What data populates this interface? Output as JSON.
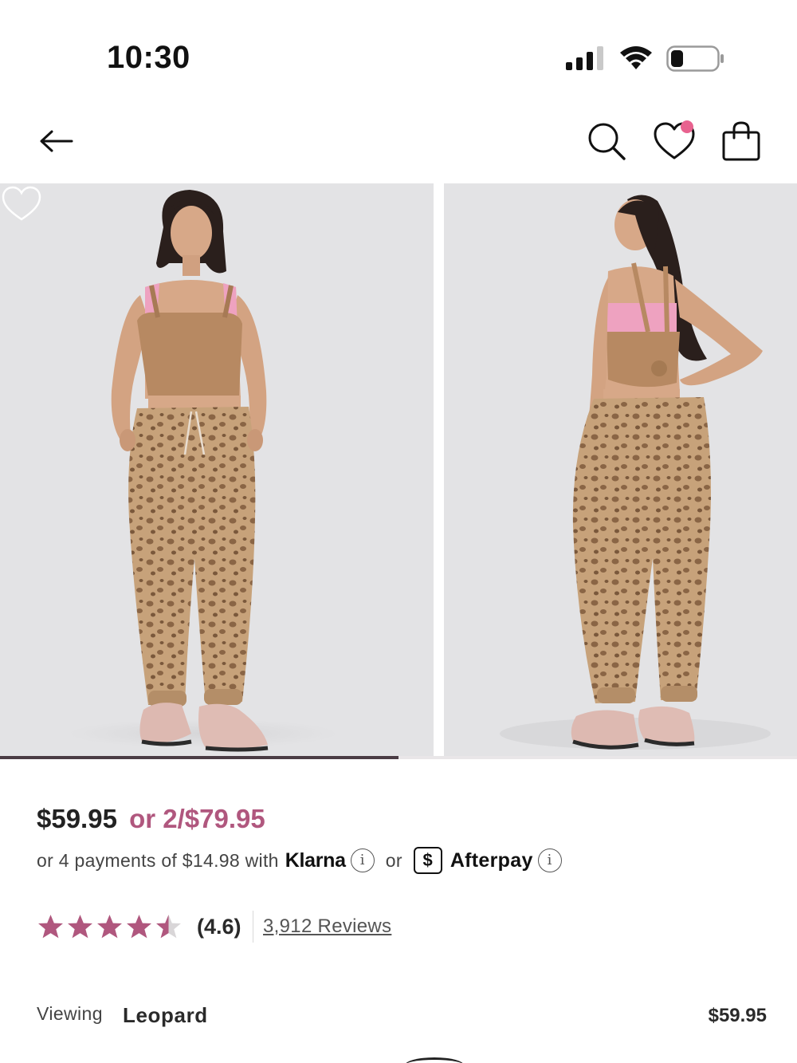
{
  "status_bar": {
    "time": "10:30",
    "signal_icon": "cellular-signal-icon",
    "wifi_icon": "wifi-icon",
    "battery_icon": "battery-icon",
    "battery_level": 0.3
  },
  "nav": {
    "back_icon": "arrow-left-icon",
    "search_icon": "search-icon",
    "wishlist_icon": "heart-icon",
    "wishlist_has_notification": true,
    "bag_icon": "shopping-bag-icon"
  },
  "gallery": {
    "image_count_visible": 2,
    "progress_fraction": 0.5,
    "favorite_icon": "heart-outline-icon"
  },
  "price": {
    "main": "$59.95",
    "deal": "or 2/$79.95",
    "deal_color": "#b0577e"
  },
  "payments": {
    "prefix": "or 4 payments of $14.98 with",
    "klarna": "Klarna",
    "or": "or",
    "afterpay_badge": "$",
    "afterpay": "Afterpay",
    "info_glyph": "i"
  },
  "rating": {
    "value": 4.6,
    "label": "(4.6)",
    "reviews": "3,912 Reviews",
    "star_color": "#b0577e",
    "star_empty_color": "#d9d6d8"
  },
  "viewing": {
    "label": "Viewing",
    "color_name": "Leopard",
    "price": "$59.95"
  },
  "colors": {
    "accent": "#b0577e",
    "progress": "#4a3c44",
    "photo_bg": "#e3e3e5"
  }
}
